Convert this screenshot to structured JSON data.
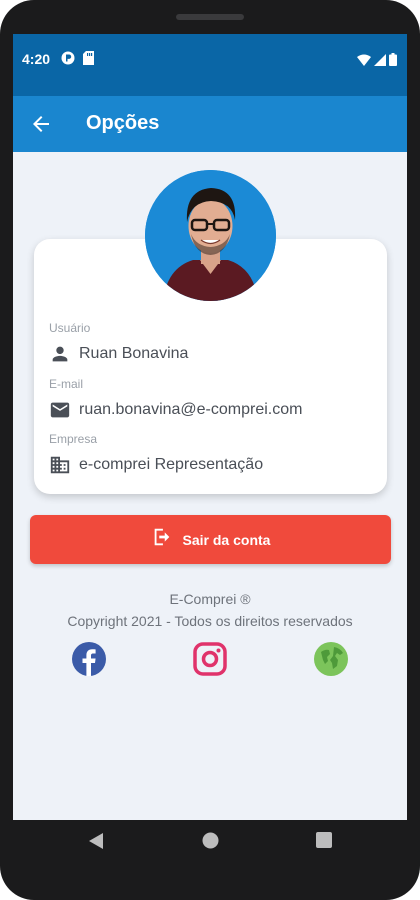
{
  "status_bar": {
    "time": "4:20",
    "icons": [
      "app-notification-icon",
      "sd-card-icon",
      "wifi-icon",
      "signal-icon",
      "battery-icon"
    ]
  },
  "app_bar": {
    "title": "Opções",
    "back_icon": "arrow-back-icon"
  },
  "profile": {
    "avatar": "profile-photo",
    "fields": [
      {
        "label": "Usuário",
        "value": "Ruan Bonavina",
        "icon": "person-icon"
      },
      {
        "label": "E-mail",
        "value": "ruan.bonavina@e-comprei.com",
        "icon": "mail-icon"
      },
      {
        "label": "Empresa",
        "value": "e-comprei Representação",
        "icon": "building-icon"
      }
    ]
  },
  "logout": {
    "label": "Sair da conta",
    "icon": "logout-icon"
  },
  "footer": {
    "brand": "E-Comprei ®",
    "copyright": "Copyright 2021 - Todos os direitos reservados",
    "social": [
      "facebook-icon",
      "instagram-icon",
      "globe-icon"
    ]
  },
  "colors": {
    "status_bar": "#0a66a6",
    "app_bar": "#1a86cf",
    "background": "#eef2f8",
    "logout": "#f04a3c",
    "facebook": "#3b5ba8",
    "instagram": "#e0336b",
    "globe": "#7cc45b"
  }
}
